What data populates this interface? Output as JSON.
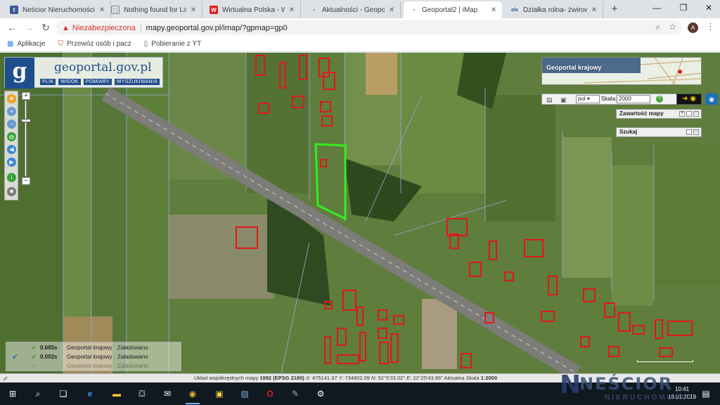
{
  "browser": {
    "tabs": [
      {
        "title": "Neścior Nieruchomości",
        "favicon": "facebook-icon",
        "color": "#3b5998",
        "glyph": "f"
      },
      {
        "title": "Nothing found for Lista",
        "favicon": "document-icon",
        "color": "#ffffff",
        "glyph": "▢"
      },
      {
        "title": "Wirtualna Polska - Wsz",
        "favicon": "wp-icon",
        "color": "#e0201a",
        "glyph": "W"
      },
      {
        "title": "Aktualności - Geoportal",
        "favicon": "geoportal-icon",
        "color": "#cccccc",
        "glyph": "◔"
      },
      {
        "title": "Geoportal2 | iMap",
        "favicon": "geoportal-icon",
        "color": "#cccccc",
        "glyph": "◔"
      },
      {
        "title": "Działka rolna- żwirowni",
        "favicon": "olx-icon",
        "color": "#ffffff",
        "glyph": "olx"
      }
    ],
    "active_tab": 4,
    "security_label": "Niezabezpieczona",
    "url": "mapy.geoportal.gov.pl/imap/?gpmap=gp0",
    "avatar_letter": "A",
    "bookmarks": [
      {
        "label": "Aplikacje",
        "icon": "apps-grid-icon"
      },
      {
        "label": "Przewóz osób i pacz",
        "icon": "shield-icon"
      },
      {
        "label": "Pobieranie z YT",
        "icon": "document-icon"
      }
    ]
  },
  "geoportal": {
    "logo_letter": "g",
    "logo_text": "geoportal.gov.pl",
    "menu": [
      "PLIK",
      "WIDOK",
      "POMIARY",
      "WYSZUKIWANIA"
    ],
    "overview_title": "Geoportal krajowy",
    "language": "pol",
    "scale_label": "Skala:",
    "scale_value": "2000",
    "panels": [
      {
        "label": "Zawartość mapy"
      },
      {
        "label": "Szukaj"
      }
    ],
    "log": [
      {
        "time": "0.665s",
        "name": "Geoportal krajowy",
        "status": "Załadowano"
      },
      {
        "time": "0.002s",
        "name": "Geoportal krajowy",
        "status": "Załadowano"
      },
      {
        "time": "",
        "name": "Geoportal krajowy",
        "status": "Załadowano"
      }
    ],
    "status_prefix": "Układ współrzędnych mapy",
    "status_crs": "1992 (EPSG 2180)",
    "status_x_label": "X:",
    "status_x": "475141.37",
    "status_y_label": "Y:",
    "status_y": "734802.09",
    "status_n_label": "N:",
    "status_n": "52°5'33.02\"",
    "status_e_label": "E:",
    "status_e": "22°25'43.86\"",
    "status_scale_label": "Aktualna Skala",
    "status_scale": "1:2000"
  },
  "taskbar": {
    "time": "10:41",
    "date": "16.01.2019"
  },
  "watermark": {
    "name": "NEŚCIOR",
    "sub": "NIERUCHOMOŚCI"
  },
  "colors": {
    "parcel_outline": "#33ee22",
    "building_outline": "#e01818",
    "geoportal_blue": "#1f4e8c"
  }
}
